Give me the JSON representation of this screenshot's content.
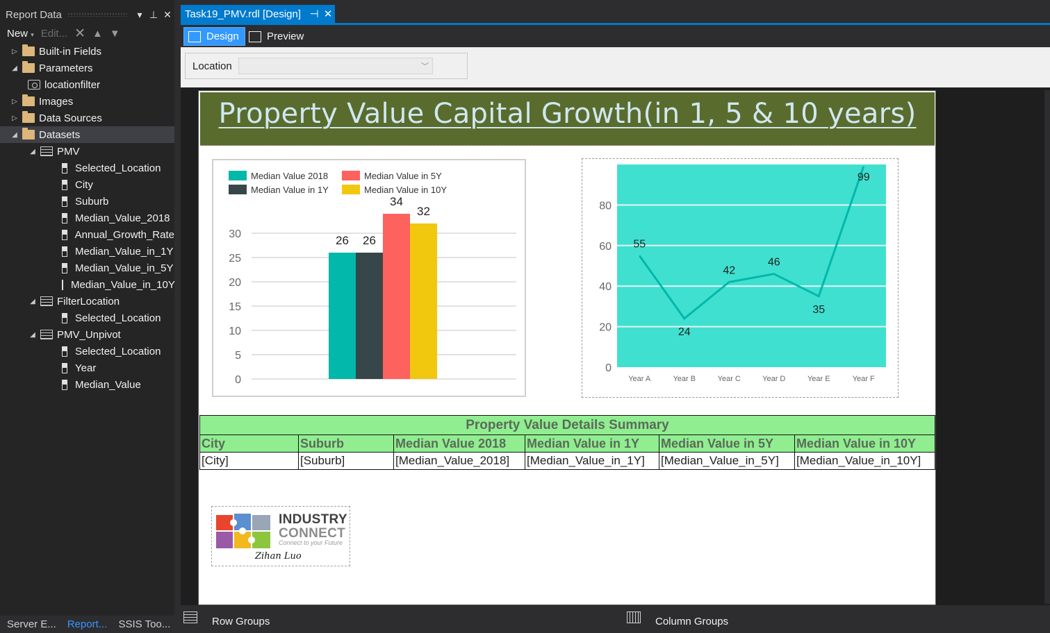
{
  "left_pane": {
    "title": "Report Data",
    "toolbar": {
      "new": "New",
      "edit": "Edit..."
    },
    "tree": [
      {
        "label": "Built-in Fields",
        "kind": "folder",
        "level": 0,
        "expanded": false
      },
      {
        "label": "Parameters",
        "kind": "folder",
        "level": 0,
        "expanded": true
      },
      {
        "label": "locationfilter",
        "kind": "parameter",
        "level": 1
      },
      {
        "label": "Images",
        "kind": "folder",
        "level": 0,
        "expanded": false
      },
      {
        "label": "Data Sources",
        "kind": "folder",
        "level": 0,
        "expanded": false
      },
      {
        "label": "Datasets",
        "kind": "folder",
        "level": 0,
        "expanded": true,
        "selected": true
      },
      {
        "label": "PMV",
        "kind": "dataset",
        "level": 1,
        "expanded": true
      },
      {
        "label": "Selected_Location",
        "kind": "field",
        "level": 2
      },
      {
        "label": "City",
        "kind": "field",
        "level": 2
      },
      {
        "label": "Suburb",
        "kind": "field",
        "level": 2
      },
      {
        "label": "Median_Value_2018",
        "kind": "field",
        "level": 2
      },
      {
        "label": "Annual_Growth_Rate",
        "kind": "field",
        "level": 2
      },
      {
        "label": "Median_Value_in_1Y",
        "kind": "field",
        "level": 2
      },
      {
        "label": "Median_Value_in_5Y",
        "kind": "field",
        "level": 2
      },
      {
        "label": "Median_Value_in_10Y",
        "kind": "field",
        "level": 2
      },
      {
        "label": "FilterLocation",
        "kind": "dataset",
        "level": 1,
        "expanded": true
      },
      {
        "label": "Selected_Location",
        "kind": "field",
        "level": 2
      },
      {
        "label": "PMV_Unpivot",
        "kind": "dataset",
        "level": 1,
        "expanded": true
      },
      {
        "label": "Selected_Location",
        "kind": "field",
        "level": 2
      },
      {
        "label": "Year",
        "kind": "field",
        "level": 2
      },
      {
        "label": "Median_Value",
        "kind": "field",
        "level": 2
      }
    ],
    "bottom_tabs": [
      {
        "label": "Server E...",
        "active": false
      },
      {
        "label": "Report...",
        "active": true
      },
      {
        "label": "SSIS Too...",
        "active": false
      }
    ]
  },
  "document": {
    "tab_title": "Task19_PMV.rdl [Design]",
    "view_buttons": {
      "design": "Design",
      "preview": "Preview"
    },
    "parameter": {
      "label": "Location",
      "value": ""
    }
  },
  "report": {
    "title": "Property Value Capital Growth(in 1, 5 & 10 years)",
    "banner_color": "#5a6b2e",
    "table": {
      "caption": "Property Value Details Summary",
      "headers": [
        "City",
        "Suburb",
        "Median Value 2018",
        "Median Value in 1Y",
        "Median Value in 5Y",
        "Median Value in 10Y"
      ],
      "row": [
        "[City]",
        "[Suburb]",
        "[Median_Value_2018]",
        "[Median_Value_in_1Y]",
        "[Median_Value_in_5Y]",
        "[Median_Value_in_10Y]"
      ],
      "header_color": "#90ee90"
    },
    "logo": {
      "line1": "INDUSTRY",
      "line2": "CONNECT",
      "tagline": "Connect to your Future",
      "signature": "Zihan Luo"
    }
  },
  "chart_data": [
    {
      "type": "bar",
      "series": [
        {
          "name": "Median Value 2018",
          "values": [
            26
          ],
          "color": "#01b8aa"
        },
        {
          "name": "Median Value in 1Y",
          "values": [
            26
          ],
          "color": "#374649"
        },
        {
          "name": "Median Value in 5Y",
          "values": [
            34
          ],
          "color": "#fd625e"
        },
        {
          "name": "Median Value in 10Y",
          "values": [
            32
          ],
          "color": "#f2c80f"
        }
      ],
      "yticks": [
        0,
        5,
        10,
        15,
        20,
        25,
        30
      ],
      "ylim": [
        0,
        35
      ],
      "grid": true,
      "legend": "top-left"
    },
    {
      "type": "line",
      "categories": [
        "Year A",
        "Year B",
        "Year C",
        "Year D",
        "Year E",
        "Year F"
      ],
      "series": [
        {
          "values": [
            55,
            24,
            42,
            46,
            35,
            99
          ],
          "color": "#01b8aa"
        }
      ],
      "yticks": [
        0,
        20,
        40,
        60,
        80
      ],
      "ylim": [
        0,
        100
      ],
      "plot_background": "#40e0d0",
      "grid": true
    }
  ],
  "bottom_bar": {
    "row_groups": "Row Groups",
    "column_groups": "Column Groups"
  }
}
